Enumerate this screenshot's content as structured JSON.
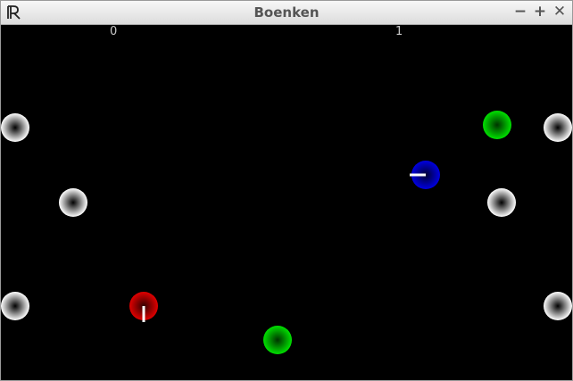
{
  "window": {
    "title": "Boenken",
    "controls": {
      "minimize": "−",
      "maximize": "+",
      "close": "✕"
    },
    "app_icon": "boenken-logo-icon"
  },
  "scores": {
    "player1": "0",
    "player2": "1"
  },
  "colors": {
    "background": "#000000",
    "player1": "#e00000",
    "player2": "#0000e0",
    "ball": "#00e000",
    "bumper": "#ffffff",
    "cue": "#ffffff"
  }
}
